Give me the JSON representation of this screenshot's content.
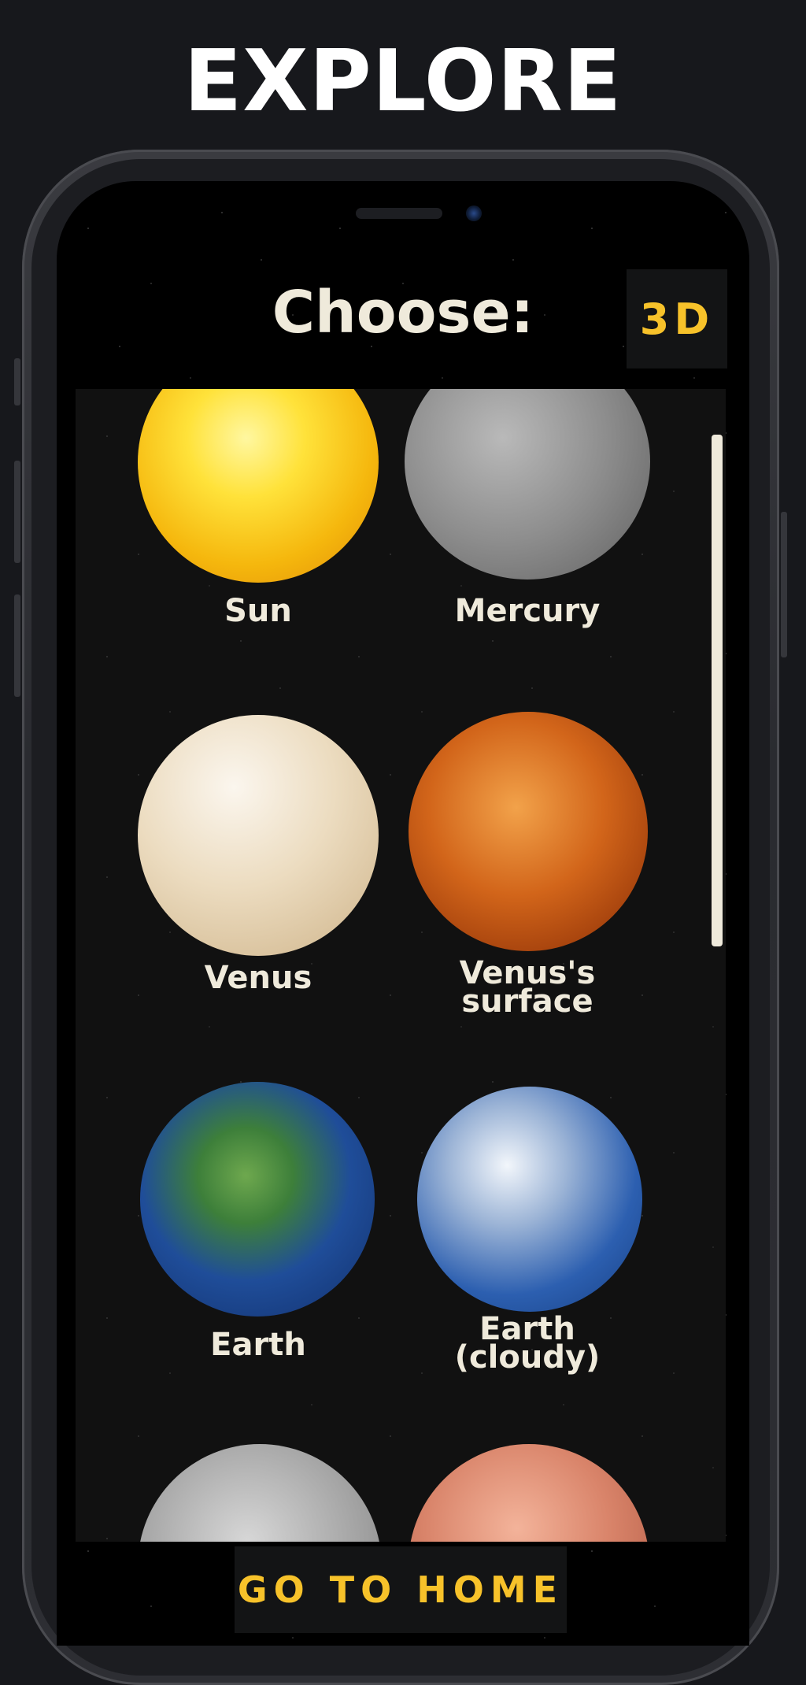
{
  "header": {
    "title": "EXPLORE"
  },
  "screen": {
    "title": "Choose:",
    "mode_button": "3D",
    "home_button": "GO TO HOME"
  },
  "planets": [
    {
      "label": "Sun",
      "icon": "sun-image"
    },
    {
      "label": "Mercury",
      "icon": "mercury-image"
    },
    {
      "label": "Venus",
      "icon": "venus-image"
    },
    {
      "label": "Venus's surface",
      "icon": "venus-surface-image"
    },
    {
      "label": "Earth",
      "icon": "earth-image"
    },
    {
      "label": "Earth (cloudy)",
      "icon": "earth-cloudy-image"
    },
    {
      "label": "",
      "icon": "moon-image"
    },
    {
      "label": "",
      "icon": "mars-image"
    }
  ],
  "colors": {
    "background": "#17181c",
    "accent": "#f7c22a",
    "label_text": "#efeadb"
  }
}
